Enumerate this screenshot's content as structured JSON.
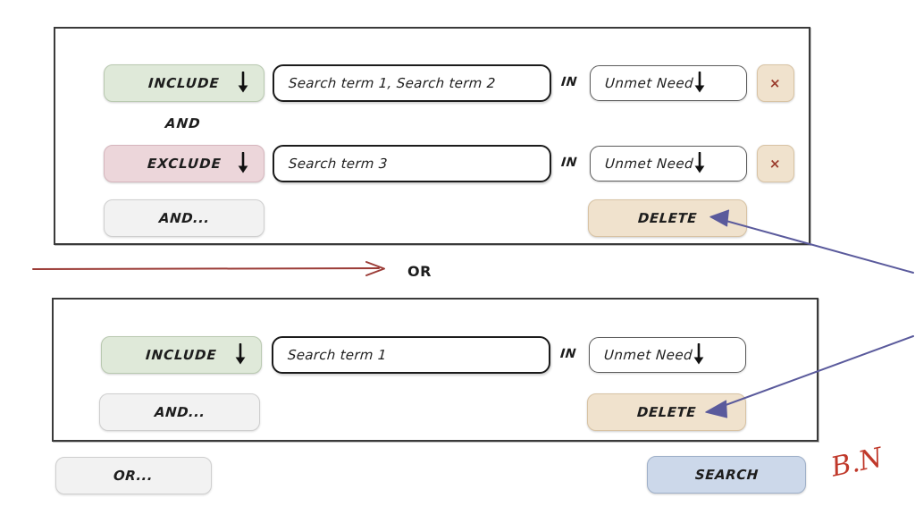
{
  "meta": {
    "title": "Search query builder wireframe",
    "annotation_initials": "B.N"
  },
  "colors": {
    "include_chip": "#dfe9d9",
    "exclude_chip": "#ecd6da",
    "delete_chip": "#f0e2cd",
    "remove_chip": "#f0e2cd",
    "remove_glyph": "#9a3b2c",
    "search_chip": "#ccd8ea",
    "ghost_chip": "#f2f2f2",
    "panel_border": "#3a3a3a",
    "callout_arrow": "#5a5a9c",
    "or_arrow": "#9b3b36",
    "initials": "#c0392b"
  },
  "group_1": {
    "rows": [
      {
        "operator": "INCLUDE",
        "operator_caret": "chevron-down-icon",
        "terms": "Search term 1, Search term 2",
        "terms_placeholder": "Search term 1, Search term 2",
        "in_word": "IN",
        "field": "Unmet Need",
        "field_caret": "chevron-down-icon",
        "remove_label": "×"
      },
      {
        "operator": "EXCLUDE",
        "operator_caret": "chevron-down-icon",
        "terms": "Search term 3",
        "terms_placeholder": "Search term 3",
        "in_word": "IN",
        "field": "Unmet Need",
        "field_caret": "chevron-down-icon",
        "remove_label": "×"
      }
    ],
    "row_connector": "AND",
    "add_condition_label": "AND...",
    "delete_label": "DELETE"
  },
  "group_connector": "OR",
  "group_2": {
    "rows": [
      {
        "operator": "INCLUDE",
        "operator_caret": "chevron-down-icon",
        "terms": "Search term 1",
        "terms_placeholder": "Search term 1",
        "in_word": "IN",
        "field": "Unmet Need",
        "field_caret": "chevron-down-icon"
      }
    ],
    "add_condition_label": "AND...",
    "delete_label": "DELETE"
  },
  "footer": {
    "add_group_label": "OR...",
    "search_label": "SEARCH"
  }
}
